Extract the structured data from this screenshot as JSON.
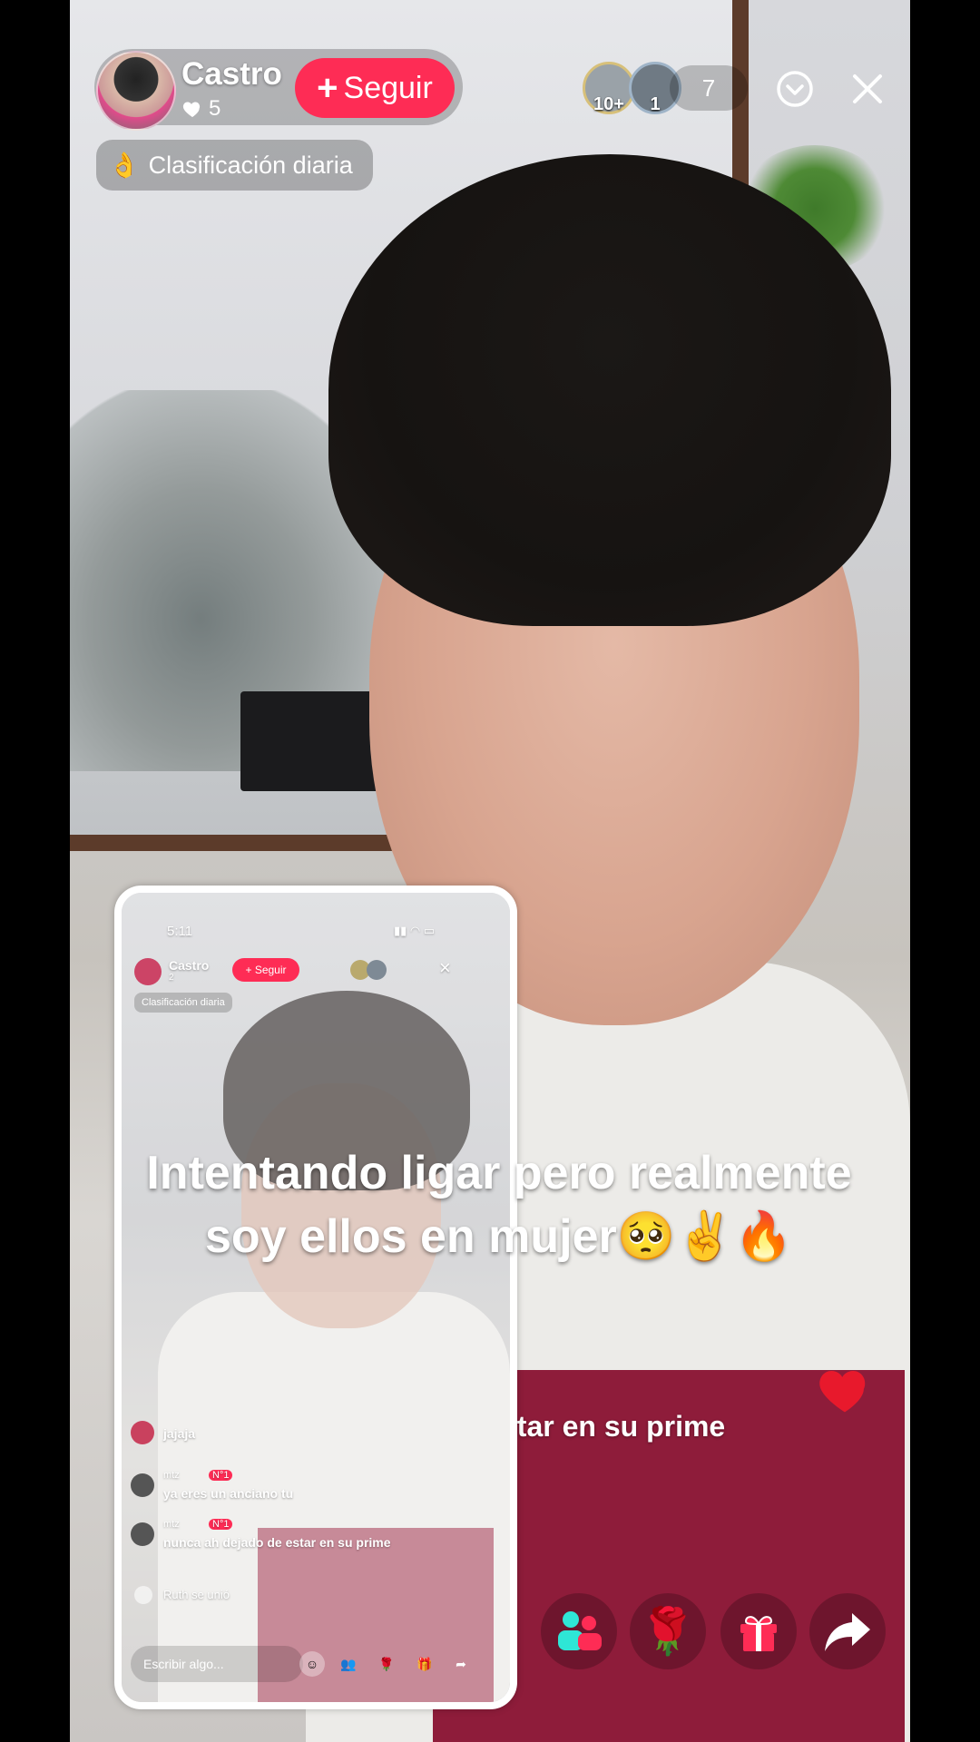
{
  "host": {
    "name": "Castro",
    "likes": "5",
    "follow_label": "Seguir"
  },
  "viewers": {
    "top": [
      {
        "badge": "10+",
        "icon": "viewer-avatar-1"
      },
      {
        "badge": "1",
        "icon": "viewer-avatar-2"
      }
    ],
    "count": "7"
  },
  "ranking": {
    "label": "Clasificación diaria",
    "icon": "fire-hand-icon"
  },
  "comments": {
    "visible_fragment": "star en su prime"
  },
  "caption": {
    "line1": "Intentando ligar pero realmente",
    "line2": "soy ellos en mujer🥺✌️🔥"
  },
  "bottom_bar": {
    "icons": [
      "multi-guest-icon",
      "rose-gift-icon",
      "gift-box-icon",
      "share-icon"
    ]
  },
  "inset_phone": {
    "status_time": "5:11",
    "host_name": "Castro",
    "host_likes": "2",
    "follow_label": "+ Seguir",
    "ranking_label": "Clasificación diaria",
    "comments": [
      {
        "text": "jajaja"
      },
      {
        "user_tag": "mtz",
        "rank": "N°1",
        "text": "ya eres un anciano tu"
      },
      {
        "user_tag": "mtz",
        "rank": "N°1",
        "text": "nunca ah dejado de estar en su prime"
      },
      {
        "text": "Ruth se unió"
      }
    ],
    "input_placeholder": "Escribir algo..."
  },
  "colors": {
    "accent": "#fe2c55",
    "heart": "#e8192c"
  }
}
